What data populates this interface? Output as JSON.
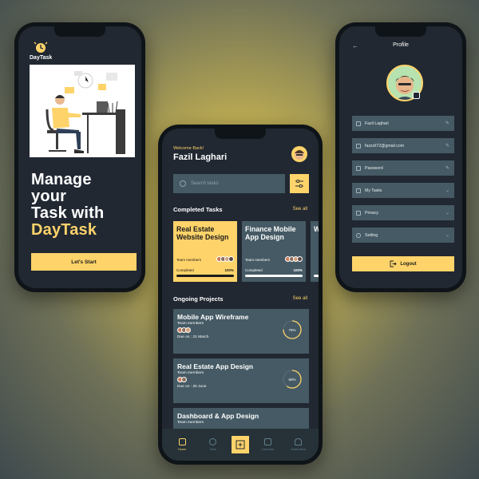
{
  "onboarding": {
    "brand": "DayTask",
    "headline_lines": [
      "Manage",
      "your",
      "Task with"
    ],
    "headline_accent": "DayTask",
    "cta_label": "Let's Start"
  },
  "home": {
    "welcome": "Welcome Back!",
    "user_name": "Fazil Laghari",
    "search_placeholder": "Search tasks",
    "completed": {
      "title": "Completed Tasks",
      "see_all": "See all",
      "cards": [
        {
          "title": "Real Estate Website Design",
          "team_label": "Team members",
          "completed_label": "Completed",
          "percent": "100%",
          "progress": 1.0,
          "style": "yellow"
        },
        {
          "title": "Finance Mobile App Design",
          "team_label": "Team members",
          "completed_label": "Completed",
          "percent": "100%",
          "progress": 1.0,
          "style": "gray"
        },
        {
          "title": "W",
          "team_label": "",
          "completed_label": "",
          "percent": "",
          "progress": 1.0,
          "style": "gray"
        }
      ]
    },
    "ongoing": {
      "title": "Ongoing Projects",
      "see_all": "See all",
      "projects": [
        {
          "title": "Mobile App Wireframe",
          "team_label": "Team members",
          "due": "Due on : 21 March",
          "percent_label": "75%",
          "progress": 0.75
        },
        {
          "title": "Real Estate App Design",
          "team_label": "Team members",
          "due": "Due on : 20 June",
          "percent_label": "60%",
          "progress": 0.6
        },
        {
          "title": "Dashboard & App Design",
          "team_label": "Team members",
          "due": "",
          "percent_label": "",
          "progress": 0
        }
      ]
    },
    "nav": {
      "home": "Home",
      "chat": "Chat",
      "calendar": "Calendar",
      "notification": "Notification"
    }
  },
  "profile": {
    "title": "Profile",
    "fields": [
      {
        "label": "Fazil Laghari",
        "icon": "user-icon",
        "trailing": "edit-icon"
      },
      {
        "label": "fazzzil72@gmail.com",
        "icon": "mail-icon",
        "trailing": "edit-icon"
      },
      {
        "label": "Password",
        "icon": "lock-icon",
        "trailing": "edit-icon"
      },
      {
        "label": "My Tasks",
        "icon": "list-icon",
        "trailing": "chevron-down-icon"
      },
      {
        "label": "Privacy",
        "icon": "shield-icon",
        "trailing": "chevron-down-icon"
      },
      {
        "label": "Setting",
        "icon": "gear-icon",
        "trailing": "chevron-down-icon"
      }
    ],
    "logout_label": "Logout"
  },
  "colors": {
    "accent": "#fed36a",
    "screen_bg": "#212832",
    "card_gray": "#455a64",
    "nav_bg": "#263238"
  }
}
